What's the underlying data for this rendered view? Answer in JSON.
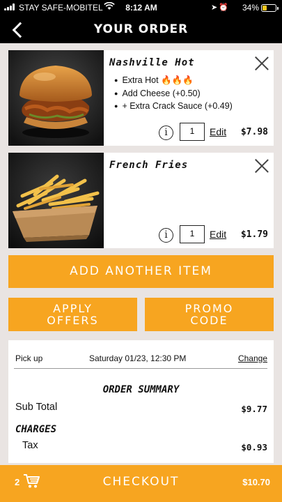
{
  "status_bar": {
    "carrier": "STAY SAFE-MOBITEL",
    "time": "8:12 AM",
    "battery_text": "34%",
    "battery_level": 0.34
  },
  "header": {
    "title": "YOUR ORDER"
  },
  "items": [
    {
      "name": "Nashville Hot",
      "options": [
        "Extra Hot 🔥🔥🔥",
        "Add Cheese (+0.50)",
        "+ Extra Crack Sauce (+0.49)"
      ],
      "quantity": "1",
      "edit_label": "Edit",
      "price": "$7.98",
      "image_icon": "chicken-sandwich"
    },
    {
      "name": "French Fries",
      "options": [],
      "quantity": "1",
      "edit_label": "Edit",
      "price": "$1.79",
      "image_icon": "french-fries"
    }
  ],
  "buttons": {
    "add_another": "ADD ANOTHER ITEM",
    "apply_offers_line1": "APPLY",
    "apply_offers_line2": "OFFERS",
    "promo_line1": "PROMO",
    "promo_line2": "CODE"
  },
  "summary": {
    "pickup_label": "Pick up",
    "pickup_time": "Saturday 01/23, 12:30 PM",
    "change_label": "Change",
    "title": "ORDER SUMMARY",
    "subtotal_label": "Sub Total",
    "subtotal_value": "$9.77",
    "charges_label": "CHARGES",
    "tax_label": "Tax",
    "tax_value": "$0.93"
  },
  "checkout": {
    "item_count": "2",
    "label": "CHECKOUT",
    "total": "$10.70"
  },
  "colors": {
    "accent": "#f7a520",
    "bar": "#000000",
    "background": "#e9e4e2"
  }
}
